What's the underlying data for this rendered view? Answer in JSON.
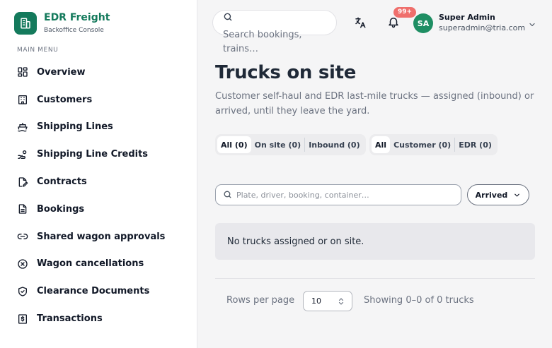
{
  "brand": {
    "name": "EDR Freight",
    "subtitle": "Backoffice Console"
  },
  "sidebar": {
    "section_title": "MAIN MENU",
    "items": [
      {
        "label": "Overview",
        "icon": "grid-icon"
      },
      {
        "label": "Customers",
        "icon": "building-icon"
      },
      {
        "label": "Shipping Lines",
        "icon": "ship-icon"
      },
      {
        "label": "Shipping Line Credits",
        "icon": "hand-coins-icon"
      },
      {
        "label": "Contracts",
        "icon": "file-edit-icon"
      },
      {
        "label": "Bookings",
        "icon": "file-text-icon"
      },
      {
        "label": "Shared wagon approvals",
        "icon": "link-icon"
      },
      {
        "label": "Wagon cancellations",
        "icon": "x-circle-icon"
      },
      {
        "label": "Clearance Documents",
        "icon": "shield-check-icon"
      },
      {
        "label": "Transactions",
        "icon": "receipt-dollar-icon"
      }
    ]
  },
  "header": {
    "search_placeholder": "Search bookings, trains…",
    "notifications_badge": "99+",
    "user": {
      "initials": "SA",
      "name": "Super Admin",
      "email": "superadmin@tria.com"
    }
  },
  "main": {
    "title": "Trucks on site",
    "description": "Customer self-haul and EDR last-mile trucks — assigned (inbound) or arrived, until they leave the yard.",
    "status_tabs": [
      {
        "label": "All (0)",
        "active": true
      },
      {
        "label": "On site (0)",
        "active": false
      },
      {
        "label": "Inbound (0)",
        "active": false
      }
    ],
    "source_tabs": [
      {
        "label": "All",
        "active": true
      },
      {
        "label": "Customer (0)",
        "active": false
      },
      {
        "label": "EDR (0)",
        "active": false
      }
    ],
    "filter_placeholder": "Plate, driver, booking, container…",
    "sort_value": "Arrived",
    "empty_message": "No trucks assigned or on site.",
    "pagination": {
      "rows_label": "Rows per page",
      "rows_value": "10",
      "summary": "Showing 0–0 of 0 trucks"
    }
  },
  "colors": {
    "brand": "#147a5c",
    "avatar": "#1e8e63",
    "badge": "#ef6f6c"
  }
}
